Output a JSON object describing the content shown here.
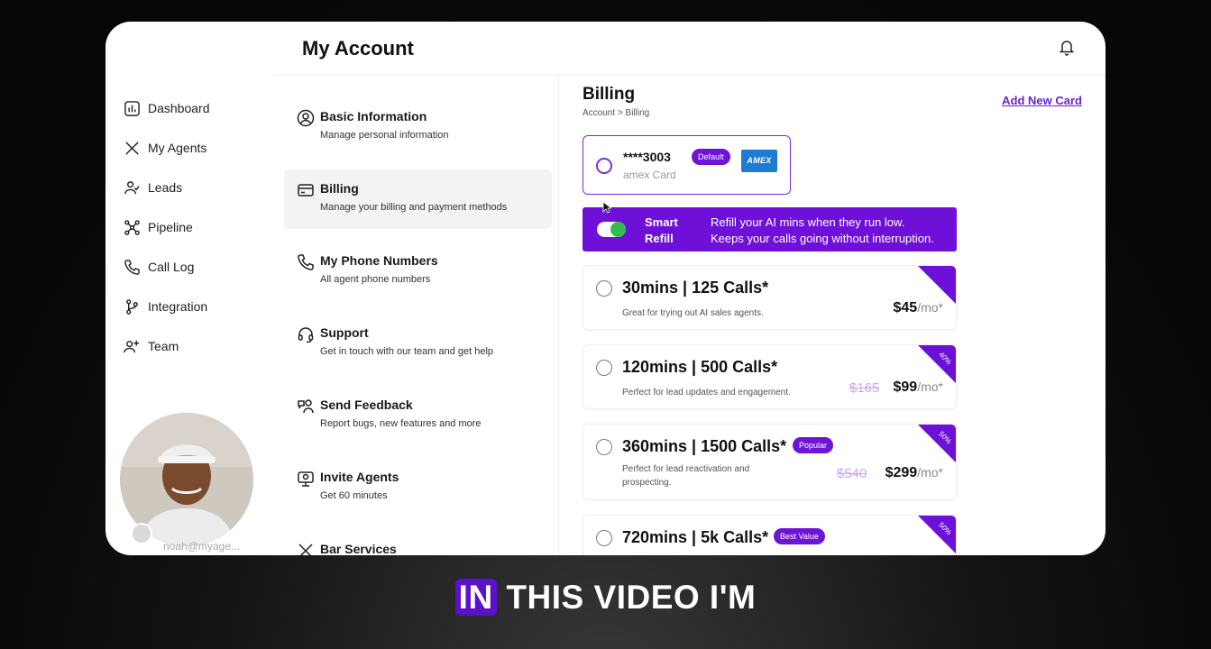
{
  "header": {
    "title": "My Account"
  },
  "sidebar": {
    "items": [
      {
        "label": "Dashboard",
        "icon": "dashboard-icon"
      },
      {
        "label": "My Agents",
        "icon": "agents-icon"
      },
      {
        "label": "Leads",
        "icon": "leads-icon"
      },
      {
        "label": "Pipeline",
        "icon": "pipeline-icon"
      },
      {
        "label": "Call Log",
        "icon": "phone-icon"
      },
      {
        "label": "Integration",
        "icon": "integration-icon"
      },
      {
        "label": "Team",
        "icon": "team-icon"
      }
    ],
    "user_email": "noah@myage..."
  },
  "menu": {
    "items": [
      {
        "title": "Basic Information",
        "subtitle": "Manage personal information",
        "icon": "user-circle-icon"
      },
      {
        "title": "Billing",
        "subtitle": "Manage your billing and payment methods",
        "icon": "credit-card-icon",
        "active": true
      },
      {
        "title": "My Phone Numbers",
        "subtitle": "All agent phone numbers",
        "icon": "phone-icon"
      },
      {
        "title": "Support",
        "subtitle": "Get in touch with our team and get help",
        "icon": "headset-icon"
      },
      {
        "title": "Send Feedback",
        "subtitle": "Report bugs, new features and more",
        "icon": "feedback-icon"
      },
      {
        "title": "Invite Agents",
        "subtitle": "Get 60 minutes",
        "icon": "invite-icon"
      },
      {
        "title": "Bar Services",
        "subtitle": "",
        "icon": "close-icon"
      }
    ]
  },
  "billing": {
    "title": "Billing",
    "breadcrumb": "Account > Billing",
    "add_card": "Add New Card",
    "card": {
      "number": "****3003",
      "type": "amex Card",
      "badge": "Default",
      "brand": "AMEX"
    },
    "smart_refill": {
      "label": "Smart Refill",
      "enabled": true,
      "line1": "Refill your AI mins when they run low.",
      "line2": "Keeps your calls going without interruption."
    },
    "plans": [
      {
        "title": "30mins | 125 Calls*",
        "desc": "Great for trying out AI sales agents.",
        "price": "$45",
        "unit": "/mo*",
        "old_price": "",
        "badge": "",
        "corner": ""
      },
      {
        "title": "120mins | 500 Calls*",
        "desc": "Perfect for lead updates and engagement.",
        "price": "$99",
        "unit": "/mo*",
        "old_price": "$165",
        "badge": "",
        "corner": "40%"
      },
      {
        "title": "360mins | 1500 Calls*",
        "desc": "Perfect for lead reactivation and prospecting.",
        "price": "$299",
        "unit": "/mo*",
        "old_price": "$540",
        "badge": "Popular",
        "corner": "50%"
      },
      {
        "title": "720mins | 5k Calls*",
        "desc": "",
        "price": "",
        "unit": "",
        "old_price": "",
        "badge": "Best Value",
        "corner": "50%"
      }
    ]
  },
  "caption": {
    "highlight": "IN",
    "rest": " THIS VIDEO I'M"
  },
  "colors": {
    "accent": "#6e10d8",
    "toggle_on": "#2fbd54",
    "amex": "#1f7ad1"
  }
}
